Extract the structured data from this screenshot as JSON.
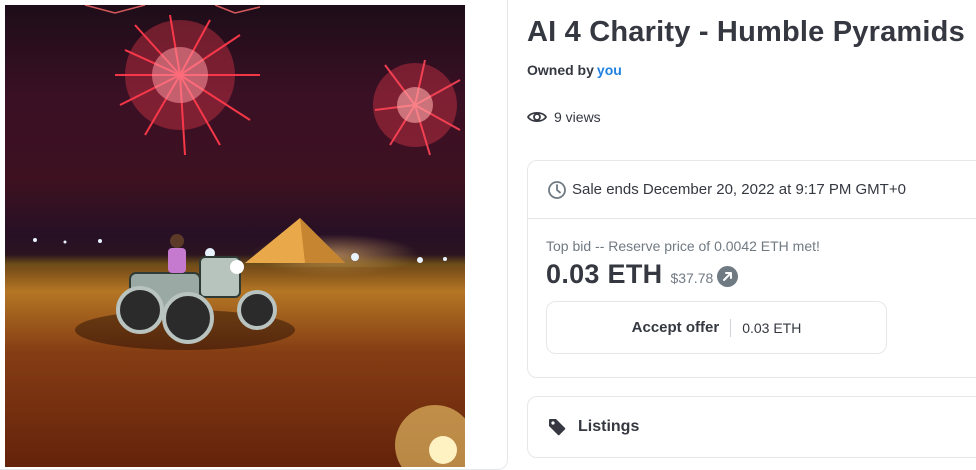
{
  "nft": {
    "title": "AI 4 Charity - Humble Pyramids",
    "owned_by_label": "Owned by",
    "owner": "you",
    "views": "9 views"
  },
  "sale": {
    "ends_text": "Sale ends December 20, 2022 at 9:17 PM GMT+0",
    "top_bid_text": "Top bid -- Reserve price of 0.0042 ETH met!",
    "price_eth": "0.03 ETH",
    "price_usd": "$37.78",
    "accept_offer_label": "Accept offer",
    "accept_offer_amount": "0.03 ETH"
  },
  "listings": {
    "label": "Listings"
  },
  "icons": {
    "views": "eye-icon",
    "sale": "clock-icon",
    "usd_link": "arrow-up-right-icon",
    "listings": "tag-icon"
  },
  "colors": {
    "link": "#2081e2",
    "text": "#353840",
    "muted": "#707a83",
    "border": "#e5e8eb"
  }
}
